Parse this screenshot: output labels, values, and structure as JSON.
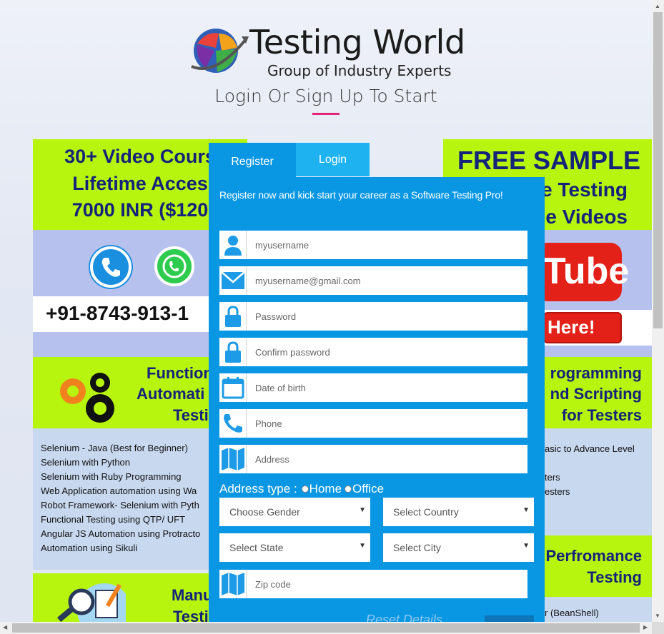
{
  "brand": {
    "title": "Testing World",
    "subtitle": "Group of Industry Experts"
  },
  "page_heading": "Login Or Sign Up To Start",
  "left_panel": {
    "course_lines": [
      "30+ Video Cours",
      "Lifetime Acces",
      "7000 INR ($120"
    ],
    "phone_number": "+91-8743-913-1",
    "func_lines": [
      "Function",
      "Automati",
      "Testi"
    ],
    "topics": [
      "Selenium - Java (Best for Beginner)",
      "Selenium with Python",
      "Selenium with Ruby Programming",
      "Web Application automation using Wa",
      "Robot Framework- Selenium with Pyth",
      "Functional Testing using QTP/ UFT",
      "Angular JS Automation using Protracto",
      "Automation using Sikuli"
    ],
    "manual_lines": [
      "Manu",
      "Testi"
    ]
  },
  "right_panel": {
    "free_lines": [
      "FREE SAMPLE",
      "e Testing",
      "e Videos"
    ],
    "yt_text": "Tube",
    "here_text": "Here!",
    "prog_lines": [
      "rogramming",
      "nd Scripting",
      "for Testers"
    ],
    "topics": [
      "asic to Advance Level",
      "ters",
      "esters"
    ],
    "perf_lines": [
      "Perfromance",
      "Testing"
    ],
    "bottom_topic": "r (BeanShell)"
  },
  "tabs": {
    "register": "Register",
    "login": "Login"
  },
  "form": {
    "intro": "Register now and kick start your career as a Software Testing Pro!",
    "fields": {
      "username": "myusername",
      "email": "myusername@gmail.com",
      "password": "Password",
      "confirm_password": "Confirm password",
      "dob": "Date of birth",
      "phone": "Phone",
      "address": "Address",
      "zip": "Zip code"
    },
    "address_type_label": "Address type :",
    "address_home": "Home",
    "address_office": "Office",
    "gender": "Choose Gender",
    "country": "Select Country",
    "state": "Select State",
    "city": "Select City",
    "bottom_hint": "Reset Details"
  },
  "colors": {
    "form_blue": "#0997e4",
    "login_tab": "#1eb3f0",
    "lime": "#b7f50f",
    "navy_text": "#15237a",
    "accent_pink": "#e2267b"
  }
}
